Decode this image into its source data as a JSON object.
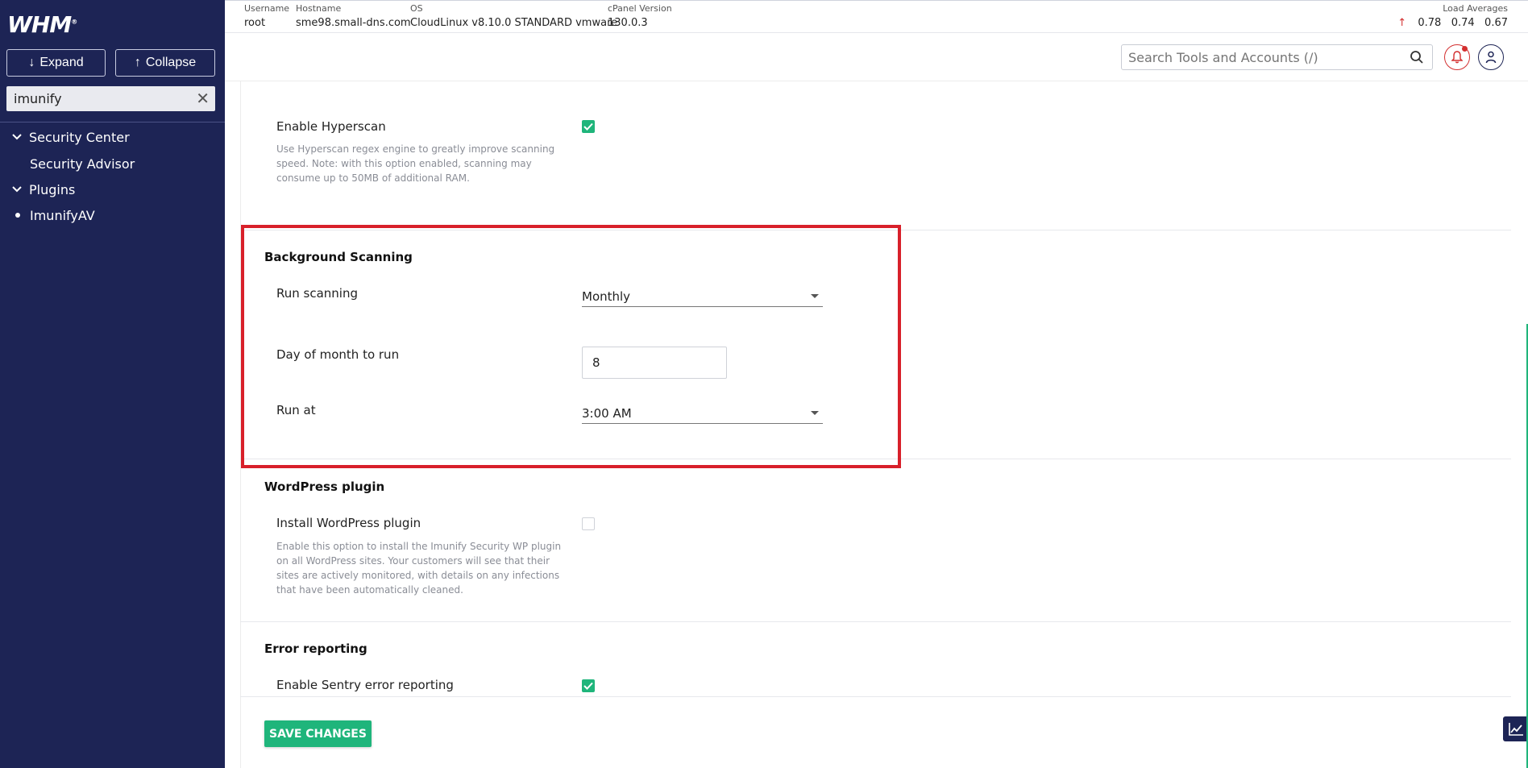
{
  "app": {
    "logo": "WHM",
    "logo_mark": "®"
  },
  "sidebar": {
    "expand_label": "Expand",
    "collapse_label": "Collapse",
    "search_value": "imunify",
    "items": [
      {
        "label": "Security Center",
        "type": "group"
      },
      {
        "label": "Security Advisor",
        "type": "child"
      },
      {
        "label": "Plugins",
        "type": "group"
      },
      {
        "label": "ImunifyAV",
        "type": "active"
      }
    ]
  },
  "topbar": {
    "username_label": "Username",
    "username": "root",
    "hostname_label": "Hostname",
    "hostname": "sme98.small-dns.com",
    "os_label": "OS",
    "os": "CloudLinux v8.10.0 STANDARD vmware",
    "cpanel_label": "cPanel Version",
    "cpanel_version": "130.0.3",
    "load_label": "Load Averages",
    "load_1": "0.78",
    "load_5": "0.74",
    "load_15": "0.67"
  },
  "header": {
    "search_placeholder": "Search Tools and Accounts (/)"
  },
  "settings": {
    "hyperscan": {
      "label": "Enable Hyperscan",
      "description": "Use Hyperscan regex engine to greatly improve scanning speed. Note: with this option enabled, scanning may consume up to 50MB of additional RAM.",
      "checked": true
    },
    "background_scanning": {
      "title": "Background Scanning",
      "run_scanning_label": "Run scanning",
      "run_scanning_value": "Monthly",
      "day_label": "Day of month to run",
      "day_value": "8",
      "run_at_label": "Run at",
      "run_at_value": "3:00 AM"
    },
    "wordpress": {
      "title": "WordPress plugin",
      "label": "Install WordPress plugin",
      "description": "Enable this option to install the Imunify Security WP plugin on all WordPress sites. Your customers will see that their sites are actively monitored, with details on any infections that have been automatically cleaned.",
      "checked": false
    },
    "error_reporting": {
      "title": "Error reporting",
      "label": "Enable Sentry error reporting",
      "checked": true
    }
  },
  "actions": {
    "save_label": "SAVE CHANGES"
  },
  "colors": {
    "sidebar_bg": "#1d2455",
    "accent_green": "#1fb57b",
    "highlight_red": "#d8202a",
    "alert_red": "#d32f2f"
  }
}
